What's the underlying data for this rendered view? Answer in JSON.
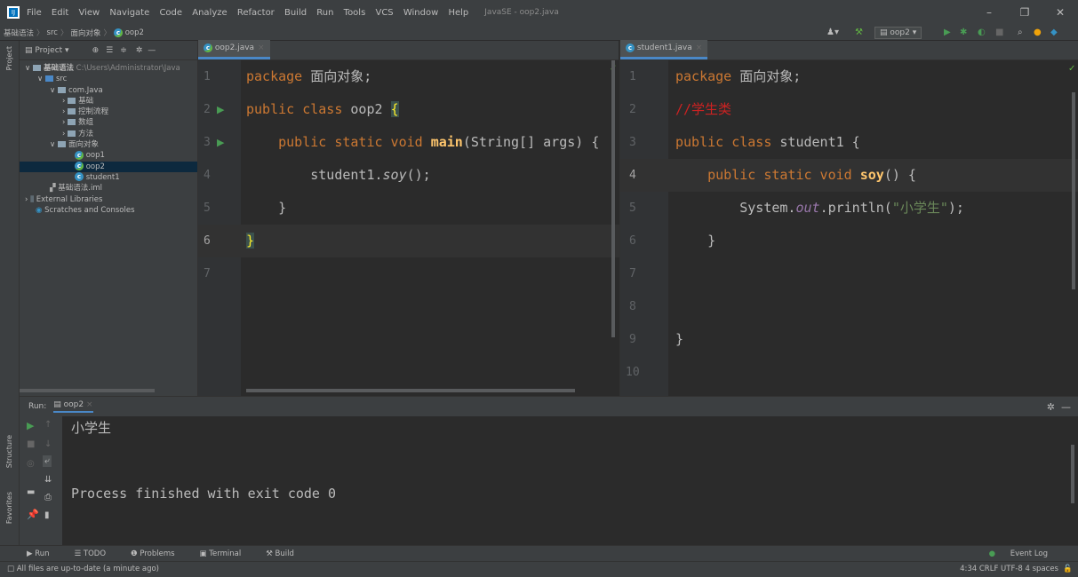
{
  "menu": [
    "File",
    "Edit",
    "View",
    "Navigate",
    "Code",
    "Analyze",
    "Refactor",
    "Build",
    "Run",
    "Tools",
    "VCS",
    "Window",
    "Help"
  ],
  "window_title": "JavaSE - oop2.java",
  "breadcrumb": [
    "基础语法",
    "src",
    "面向对象",
    "oop2"
  ],
  "run_config": "oop2",
  "project_panel": {
    "title": "Project",
    "root_name": "基础语法",
    "root_path": "C:\\Users\\Administrator\\Java",
    "items": [
      "src",
      "com.Java",
      "基础",
      "控制流程",
      "数组",
      "方法",
      "面向对象",
      "oop1",
      "oop2",
      "student1",
      "基础语法.iml",
      "External Libraries",
      "Scratches and Consoles"
    ]
  },
  "left_editor": {
    "tab": "oop2.java",
    "lines": [
      "1",
      "2",
      "3",
      "4",
      "5",
      "6",
      "7"
    ]
  },
  "right_editor": {
    "tab": "student1.java",
    "lines": [
      "1",
      "2",
      "3",
      "4",
      "5",
      "6",
      "7",
      "8",
      "9",
      "10"
    ]
  },
  "code": {
    "package_kw": "package",
    "package_name": " 面向对象;",
    "public_class": "public class",
    "oop2_name": " oop2 ",
    "brace_open": "{",
    "main_kw": "public static void",
    "main_name": "main",
    "main_args": "(String[] args) {",
    "call_class": "student1.",
    "call_method": "soy",
    "call_end": "();",
    "brace_close": "}",
    "comment": "//学生类",
    "student_name": " student1 {",
    "soy_name": "soy",
    "soy_end": "() {",
    "sysout_a": "System.",
    "sysout_b": "out",
    "sysout_c": ".println(",
    "sysout_str": "\"小学生\"",
    "sysout_d": ");"
  },
  "run_panel": {
    "label": "Run:",
    "tab": "oop2",
    "output_line1": "小学生",
    "output_line2": "Process finished with exit code 0"
  },
  "bottom_tabs": [
    "Run",
    "TODO",
    "Problems",
    "Terminal",
    "Build"
  ],
  "event_log": "Event Log",
  "status_message": "All files are up-to-date (a minute ago)",
  "status_right": "4:34  CRLF  UTF-8  4 spaces",
  "side_labels": {
    "project": "Project",
    "structure": "Structure",
    "favorites": "Favorites"
  }
}
